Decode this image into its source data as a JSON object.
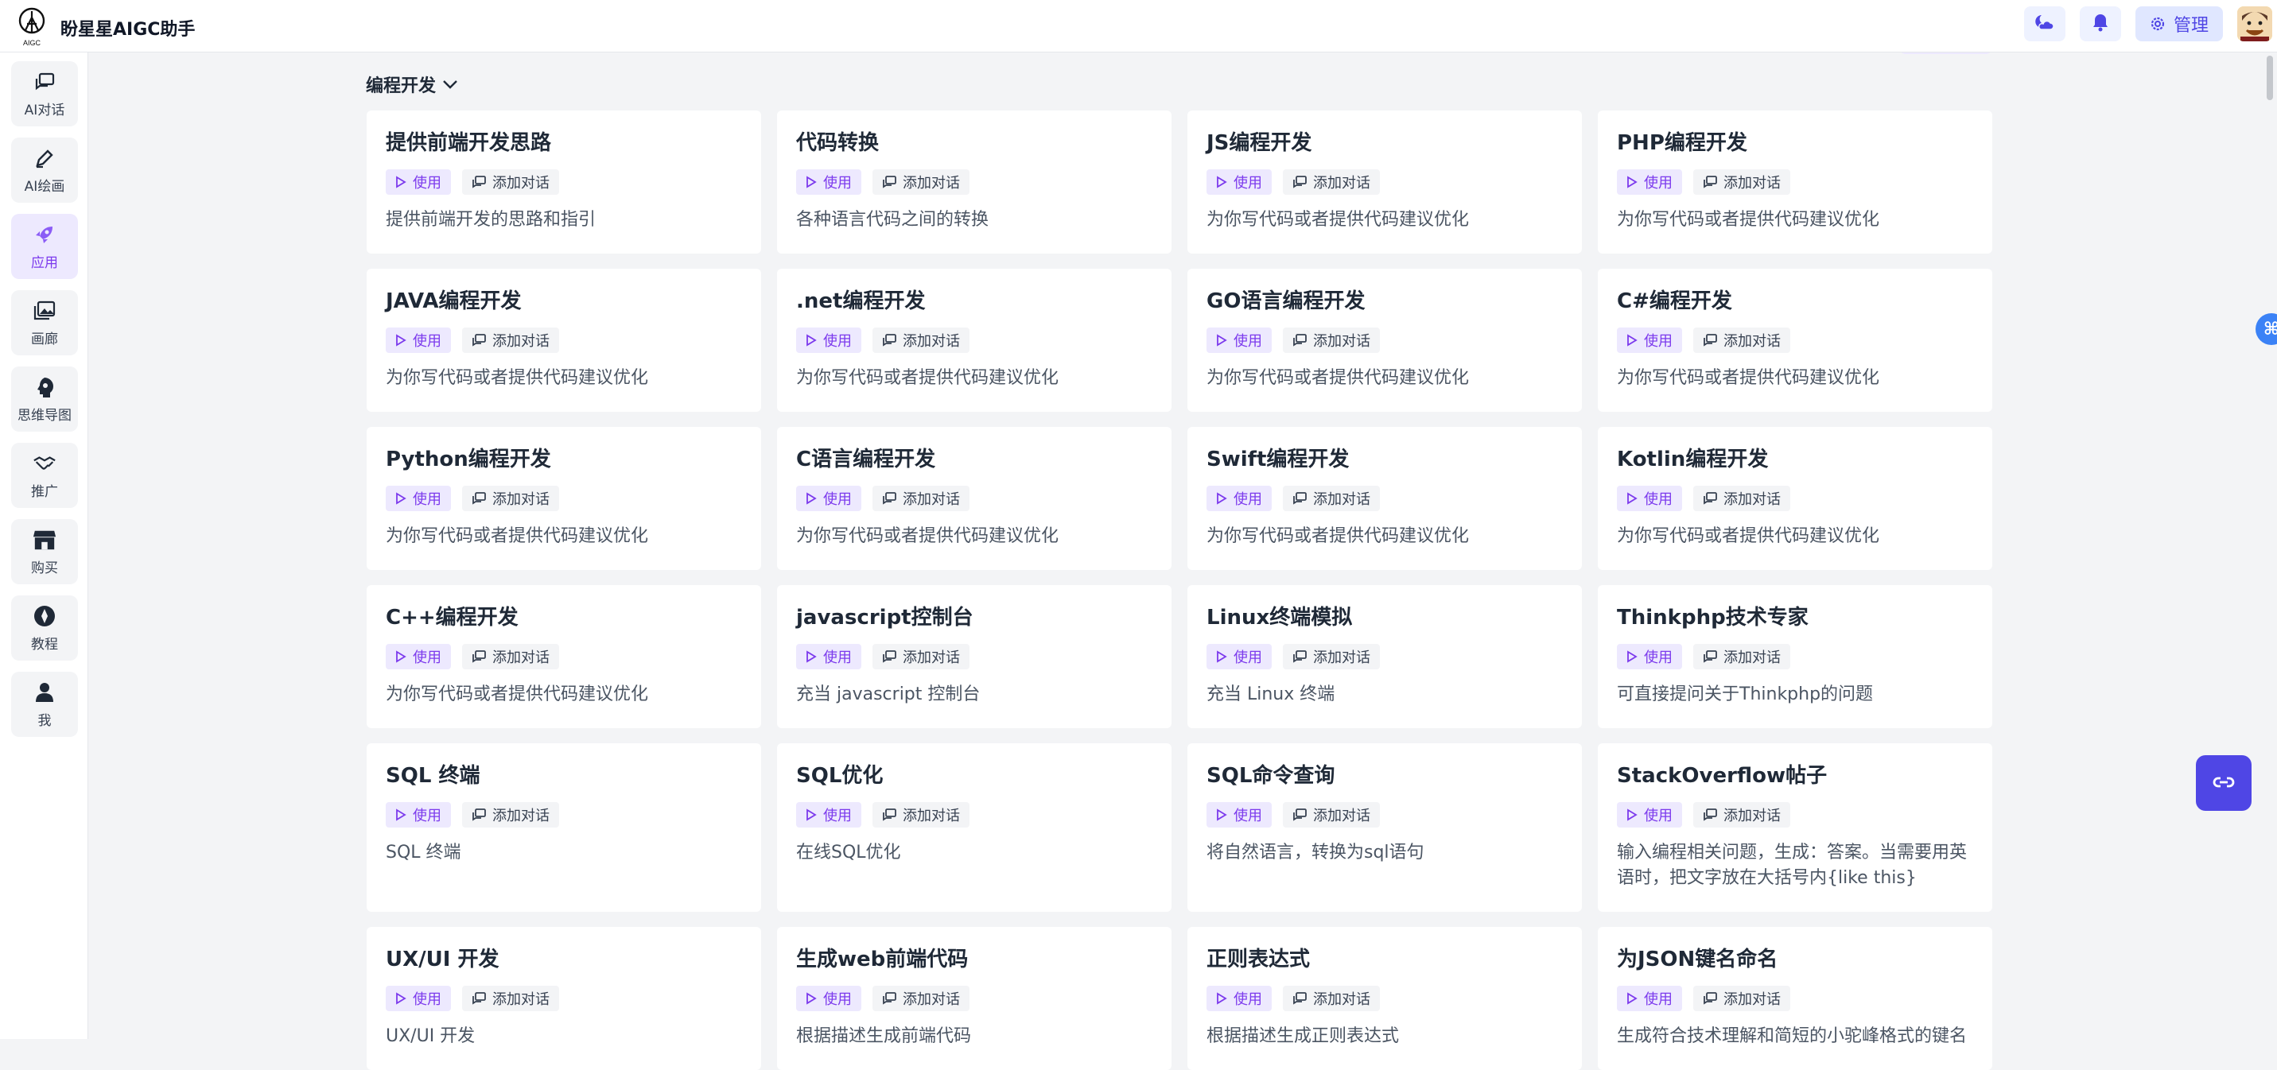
{
  "header": {
    "logo_text": "AIGC",
    "title": "盼星星AIGC助手",
    "manage_label": "管理",
    "buttons": [
      "weather-icon",
      "bell-icon",
      "gear-icon"
    ]
  },
  "sidebar": {
    "items": [
      {
        "label": "AI对话",
        "icon": "chat-icon",
        "active": false
      },
      {
        "label": "AI绘画",
        "icon": "pen-icon",
        "active": false
      },
      {
        "label": "应用",
        "icon": "rocket-icon",
        "active": true
      },
      {
        "label": "画廊",
        "icon": "gallery-icon",
        "active": false
      },
      {
        "label": "思维导图",
        "icon": "brain-icon",
        "active": false
      },
      {
        "label": "推广",
        "icon": "handshake-icon",
        "active": false
      },
      {
        "label": "购买",
        "icon": "store-icon",
        "active": false
      },
      {
        "label": "教程",
        "icon": "compass-icon",
        "active": false
      },
      {
        "label": "我",
        "icon": "user-icon",
        "active": false
      }
    ]
  },
  "section": {
    "title": "编程开发"
  },
  "card_actions": {
    "use_label": "使用",
    "add_label": "添加对话"
  },
  "cards": [
    {
      "title": "提供前端开发思路",
      "desc": "提供前端开发的思路和指引"
    },
    {
      "title": "代码转换",
      "desc": "各种语言代码之间的转换"
    },
    {
      "title": "JS编程开发",
      "desc": "为你写代码或者提供代码建议优化"
    },
    {
      "title": "PHP编程开发",
      "desc": "为你写代码或者提供代码建议优化"
    },
    {
      "title": "JAVA编程开发",
      "desc": "为你写代码或者提供代码建议优化"
    },
    {
      "title": ".net编程开发",
      "desc": "为你写代码或者提供代码建议优化"
    },
    {
      "title": "GO语言编程开发",
      "desc": "为你写代码或者提供代码建议优化"
    },
    {
      "title": "C#编程开发",
      "desc": "为你写代码或者提供代码建议优化"
    },
    {
      "title": "Python编程开发",
      "desc": "为你写代码或者提供代码建议优化"
    },
    {
      "title": "C语言编程开发",
      "desc": "为你写代码或者提供代码建议优化"
    },
    {
      "title": "Swift编程开发",
      "desc": "为你写代码或者提供代码建议优化"
    },
    {
      "title": "Kotlin编程开发",
      "desc": "为你写代码或者提供代码建议优化"
    },
    {
      "title": "C++编程开发",
      "desc": "为你写代码或者提供代码建议优化"
    },
    {
      "title": "javascript控制台",
      "desc": "充当 javascript 控制台"
    },
    {
      "title": "Linux终端模拟",
      "desc": "充当 Linux 终端"
    },
    {
      "title": "Thinkphp技术专家",
      "desc": "可直接提问关于Thinkphp的问题"
    },
    {
      "title": "SQL 终端",
      "desc": "SQL 终端"
    },
    {
      "title": "SQL优化",
      "desc": "在线SQL优化"
    },
    {
      "title": "SQL命令查询",
      "desc": "将自然语言，转换为sql语句"
    },
    {
      "title": "StackOverflow帖子",
      "desc": "输入编程相关问题，生成：答案。当需要用英语时，把文字放在大括号内{like this}"
    },
    {
      "title": "UX/UI 开发",
      "desc": "UX/UI 开发"
    },
    {
      "title": "生成web前端代码",
      "desc": "根据描述生成前端代码"
    },
    {
      "title": "正则表达式",
      "desc": "根据描述生成正则表达式"
    },
    {
      "title": "为JSON键名命名",
      "desc": "生成符合技术理解和简短的小驼峰格式的键名"
    }
  ],
  "floating": {
    "icon": "share-icon",
    "edge_icon": "command-icon",
    "edge_glyph": "⌘"
  },
  "colors": {
    "accent": "#7c3aed",
    "accent_bg": "#ede9fe",
    "primary": "#4f46e5"
  }
}
